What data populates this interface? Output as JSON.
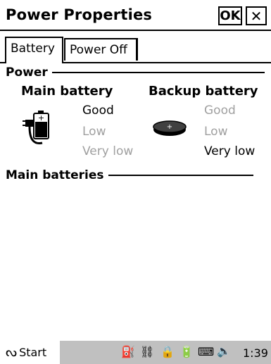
{
  "window": {
    "title": "Power Properties",
    "ok_label": "OK",
    "close_label": "✕"
  },
  "tabs": [
    {
      "label": "Battery"
    },
    {
      "label": "Power Off"
    }
  ],
  "power_group": {
    "label": "Power"
  },
  "main_battery": {
    "title": "Main battery",
    "levels": [
      "Good",
      "Low",
      "Very low"
    ],
    "current": "Good"
  },
  "backup_battery": {
    "title": "Backup battery",
    "levels": [
      "Good",
      "Low",
      "Very low"
    ],
    "current": "Very low"
  },
  "main_batteries_group": {
    "label": "Main batteries"
  },
  "taskbar": {
    "start_label": "Start",
    "time": "1:39"
  },
  "icons": [
    "battery-plug-icon",
    "coin-cell-icon",
    "start-flag-icon",
    "connectivity-icon",
    "network-icon",
    "lock-icon",
    "battery-tray-icon",
    "keyboard-icon",
    "speaker-icon"
  ],
  "colors": {
    "dim_text": "#a0a0a0",
    "taskbar": "#c0c0c0"
  }
}
